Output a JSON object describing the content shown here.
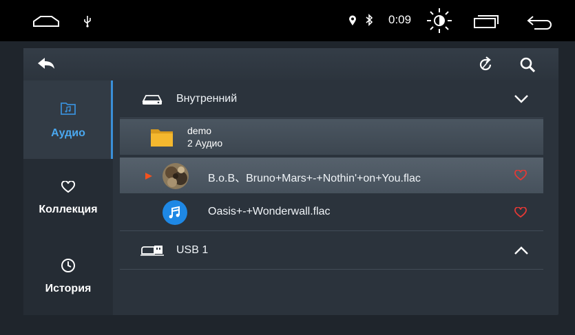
{
  "status_bar": {
    "time": "0:09",
    "icons": [
      "home-icon",
      "usb-icon",
      "location-icon",
      "bluetooth-icon",
      "brightness-icon",
      "recent-apps-icon",
      "back-icon"
    ]
  },
  "toolbar": {
    "icons": [
      "back-arrow-icon",
      "refresh-icon",
      "search-icon"
    ]
  },
  "sidebar": {
    "items": [
      {
        "label": "Аудио",
        "icon": "music-folder-icon",
        "active": true
      },
      {
        "label": "Коллекция",
        "icon": "heart-icon",
        "active": false
      },
      {
        "label": "История",
        "icon": "clock-icon",
        "active": false
      }
    ]
  },
  "list": {
    "internal_storage": {
      "label": "Внутренний",
      "icon": "drive-icon",
      "expanded": true
    },
    "folder": {
      "name": "demo",
      "count": "2 Аудио",
      "icon": "folder-icon"
    },
    "tracks": [
      {
        "title": "B.o.B、Bruno+Mars+-+Nothin'+on+You.flac",
        "playing": true,
        "favorite": false
      },
      {
        "title": "Oasis+-+Wonderwall.flac",
        "playing": false,
        "favorite": false
      }
    ],
    "usb": {
      "label": "USB 1",
      "icon": "usb-drive-icon",
      "expanded": false
    }
  },
  "colors": {
    "accent": "#3a8fd8",
    "favorite": "#e53935",
    "play_indicator": "#f4511e",
    "folder": "#f5b82e"
  }
}
